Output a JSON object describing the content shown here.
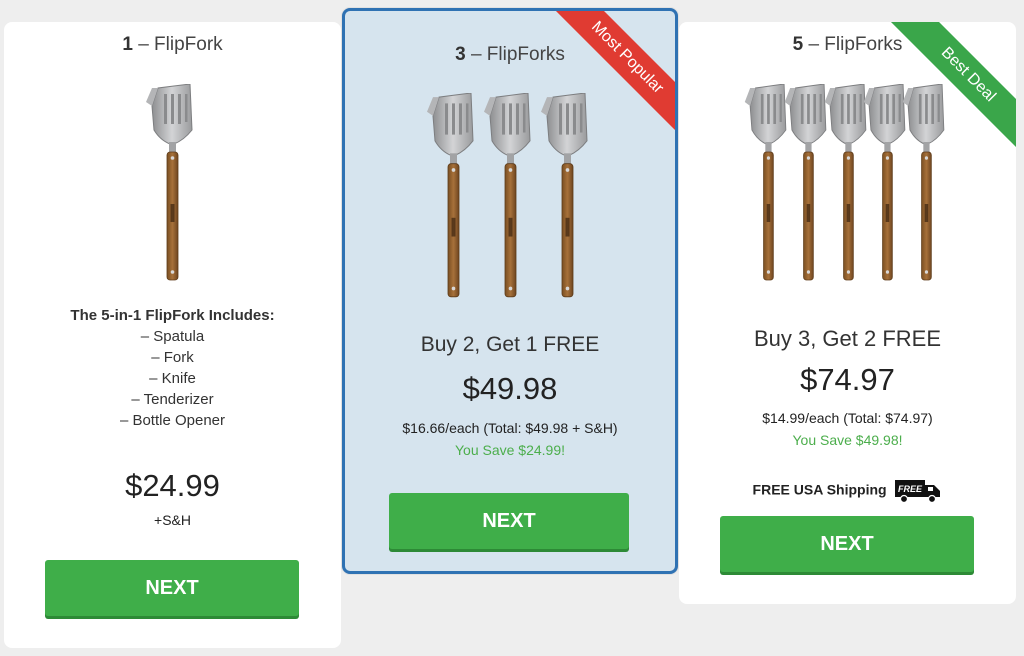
{
  "packages": [
    {
      "title_qty": "1",
      "title_name": "– FlipFork",
      "includes_heading": "The 5-in-1 FlipFork Includes:",
      "includes": [
        "– Spatula",
        "– Fork",
        "– Knife",
        "– Tenderizer",
        "– Bottle Opener"
      ],
      "price": "$24.99",
      "price_note": "+S&H",
      "button": "NEXT"
    },
    {
      "title_qty": "3",
      "title_name": "– FlipForks",
      "ribbon": "Most Popular",
      "offer": "Buy 2, Get 1 FREE",
      "price": "$49.98",
      "per_each": "$16.66/each (Total: $49.98 + S&H)",
      "savings": "You Save $24.99!",
      "button": "NEXT"
    },
    {
      "title_qty": "5",
      "title_name": "– FlipForks",
      "ribbon": "Best Deal",
      "offer": "Buy 3, Get 2 FREE",
      "price": "$74.97",
      "per_each": "$14.99/each (Total: $74.97)",
      "savings": "You Save $49.98!",
      "shipping": "FREE USA Shipping",
      "truck_label": "FREE",
      "button": "NEXT"
    }
  ],
  "colors": {
    "button_green": "#3fae49",
    "savings_green": "#4cae4c",
    "popular_ribbon": "#e03b32",
    "best_ribbon": "#3aa64a",
    "highlight_border": "#2f72b3",
    "highlight_bg": "#d6e4ee"
  },
  "icons": [
    "flipfork-product-icon",
    "free-shipping-truck-icon"
  ]
}
